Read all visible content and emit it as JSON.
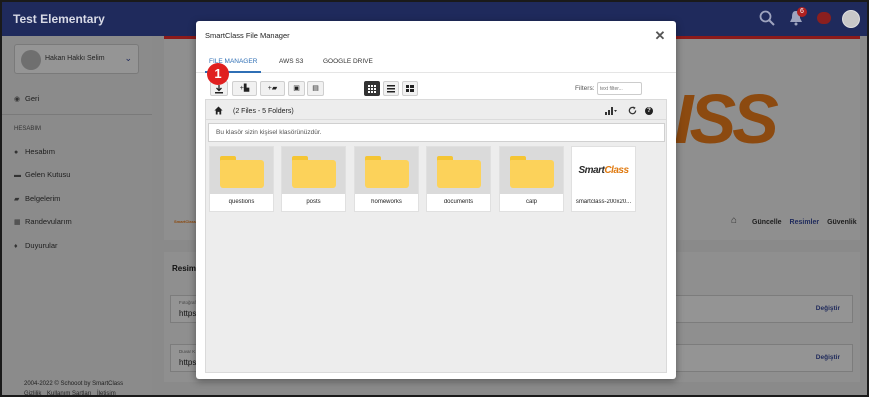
{
  "app": {
    "title": "Test Elementary",
    "notification_count": "6",
    "brand_text": "ISS",
    "tiny_logo": "SmartClass"
  },
  "sidebar": {
    "user_name": "Hakan Hakkı Selim",
    "back_label": "Geri",
    "section_header": "HESABIM",
    "items": [
      {
        "label": "Hesabım",
        "icon": "user-icon"
      },
      {
        "label": "Gelen Kutusu",
        "icon": "inbox-icon"
      },
      {
        "label": "Belgelerim",
        "icon": "folder-icon"
      },
      {
        "label": "Randevularım",
        "icon": "calendar-icon"
      },
      {
        "label": "Duyurular",
        "icon": "megaphone-icon"
      }
    ],
    "footer_copyright": "2004-2022 © Schooot by SmartClass",
    "footer_links": [
      "Gizlilik",
      "Kullanım Şartları",
      "İletişim"
    ]
  },
  "content": {
    "nav_links": [
      "Güncelle",
      "Resimler",
      "Güvenlik"
    ],
    "active_nav": "Resimler",
    "section_title": "Resimle",
    "fields": [
      {
        "label": "Fotoğraf",
        "value": "https:/",
        "button": "Değiştir"
      },
      {
        "label": "Duvar K",
        "value": "https:/",
        "button": "Değiştir"
      }
    ]
  },
  "modal": {
    "title": "SmartClass File Manager",
    "tabs": [
      "FILE MANAGER",
      "AWS S3",
      "GOOGLE DRIVE"
    ],
    "active_tab": "FILE MANAGER",
    "step_badge": "1",
    "toolbar": {
      "upload": "⤓",
      "new_file": "+▙",
      "new_folder": "+▰",
      "paste": "▣",
      "clipboard": "▤"
    },
    "filters_label": "Filters:",
    "filter_placeholder": "text filter...",
    "path_summary": "(2 Files - 5 Folders)",
    "notice": "Bu klasör sizin kişisel klasörünüzdür.",
    "items": [
      {
        "name": "questions",
        "type": "folder"
      },
      {
        "name": "posts",
        "type": "folder"
      },
      {
        "name": "homeworks",
        "type": "folder"
      },
      {
        "name": "documents",
        "type": "folder"
      },
      {
        "name": "calp",
        "type": "folder"
      },
      {
        "name": "smartclass-200x20...",
        "type": "image",
        "logo_part1": "Smart",
        "logo_part2": "Class"
      }
    ]
  },
  "colors": {
    "topbar": "#1f2a5c",
    "accent_tab": "#2f6fb5",
    "badge": "#e02020",
    "folder": "#fcd25a",
    "brand": "#e07a10"
  }
}
